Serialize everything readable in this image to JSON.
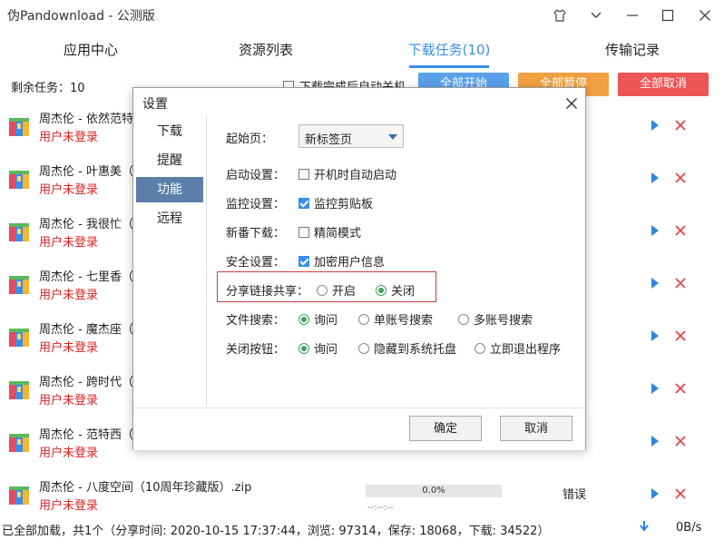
{
  "app": {
    "title": "伪Pandownload - 公测版"
  },
  "window_controls": [
    "shirt-icon",
    "chevron-down-icon",
    "minimize-icon",
    "maximize-icon",
    "close-icon"
  ],
  "nav": {
    "tabs": [
      {
        "label": "应用中心"
      },
      {
        "label": "资源列表"
      },
      {
        "label": "下载任务(10)"
      },
      {
        "label": "传输记录"
      }
    ],
    "active": 2
  },
  "toolbar": {
    "remaining": "剩余任务：10",
    "auto_shutdown_label": "下载完成后自动关机",
    "start_all": "全部开始",
    "pause_all": "全部暂停",
    "cancel_all": "全部取消",
    "colors": {
      "start": "#5aa0ea",
      "pause": "#f0a040",
      "cancel": "#ee5555"
    }
  },
  "tasks": [
    {
      "name": "周杰伦 - 依然范特西",
      "status": "用户未登录"
    },
    {
      "name": "周杰伦 - 叶惠美（",
      "status": "用户未登录"
    },
    {
      "name": "周杰伦 - 我很忙（",
      "status": "用户未登录"
    },
    {
      "name": "周杰伦 - 七里香（",
      "status": "用户未登录"
    },
    {
      "name": "周杰伦 - 魔杰座（",
      "status": "用户未登录"
    },
    {
      "name": "周杰伦 - 跨时代（",
      "status": "用户未登录"
    },
    {
      "name": "周杰伦 - 范特西（",
      "status": "用户未登录"
    },
    {
      "name": "周杰伦 - 八度空间（10周年珍藏版）.zip",
      "status": "用户未登录",
      "progress": "0.0%",
      "eta": "--:--:--",
      "state": "错误"
    }
  ],
  "status_bar": {
    "text": "已全部加载，共1个（分享时间: 2020-10-15 17:37:44，浏览: 97314，保存: 18068，下载: 34522）",
    "speed": "0B/s"
  },
  "dialog": {
    "title": "设置",
    "sidebar": [
      "下载",
      "提醒",
      "功能",
      "远程"
    ],
    "active_section": 2,
    "start_page": {
      "label": "起始页：",
      "value": "新标签页"
    },
    "startup": {
      "label": "启动设置：",
      "option": "开机时自动启动",
      "checked": false
    },
    "monitor": {
      "label": "监控设置：",
      "option": "监控剪贴板",
      "checked": true
    },
    "new_download": {
      "label": "新番下载：",
      "option": "精简模式",
      "checked": false
    },
    "security": {
      "label": "安全设置：",
      "option": "加密用户信息",
      "checked": true
    },
    "share_link": {
      "label": "分享链接共享：",
      "options": [
        "开启",
        "关闭"
      ],
      "selected": 1
    },
    "file_search": {
      "label": "文件搜索：",
      "options": [
        "询问",
        "单账号搜索",
        "多账号搜索"
      ],
      "selected": 0
    },
    "close_button": {
      "label": "关闭按钮：",
      "options": [
        "询问",
        "隐藏到系统托盘",
        "立即退出程序"
      ],
      "selected": 0
    },
    "ok": "确定",
    "cancel": "取消",
    "highlight_color": "#d23a3a"
  }
}
